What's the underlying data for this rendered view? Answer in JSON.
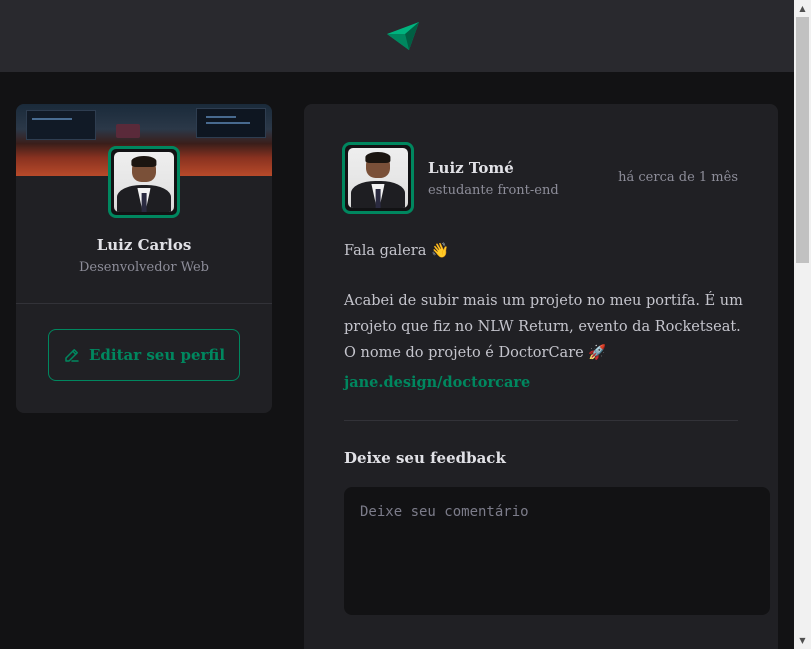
{
  "header": {
    "logo_icon": "ignite-logo-icon"
  },
  "sidebar": {
    "name": "Luiz Carlos",
    "role": "Desenvolvedor Web",
    "edit_button_label": "Editar seu perfil",
    "edit_icon": "pencil-line-icon"
  },
  "post": {
    "author": {
      "name": "Luiz Tomé",
      "role": "estudante front-end"
    },
    "time": "há cerca de 1 mês",
    "paragraphs": [
      "Fala galera 👋",
      "Acabei de subir mais um projeto no meu portifa. É um projeto que fiz no NLW Return, evento da Rocketseat. O nome do projeto é DoctorCare 🚀"
    ],
    "link": "jane.design/doctorcare",
    "feedback": {
      "title": "Deixe seu feedback",
      "placeholder": "Deixe seu comentário"
    }
  },
  "colors": {
    "background": "#121214",
    "header": "#29292e",
    "card": "#202024",
    "accent": "#00875f",
    "text": "#e1e1e6",
    "muted": "#8d8d99"
  }
}
